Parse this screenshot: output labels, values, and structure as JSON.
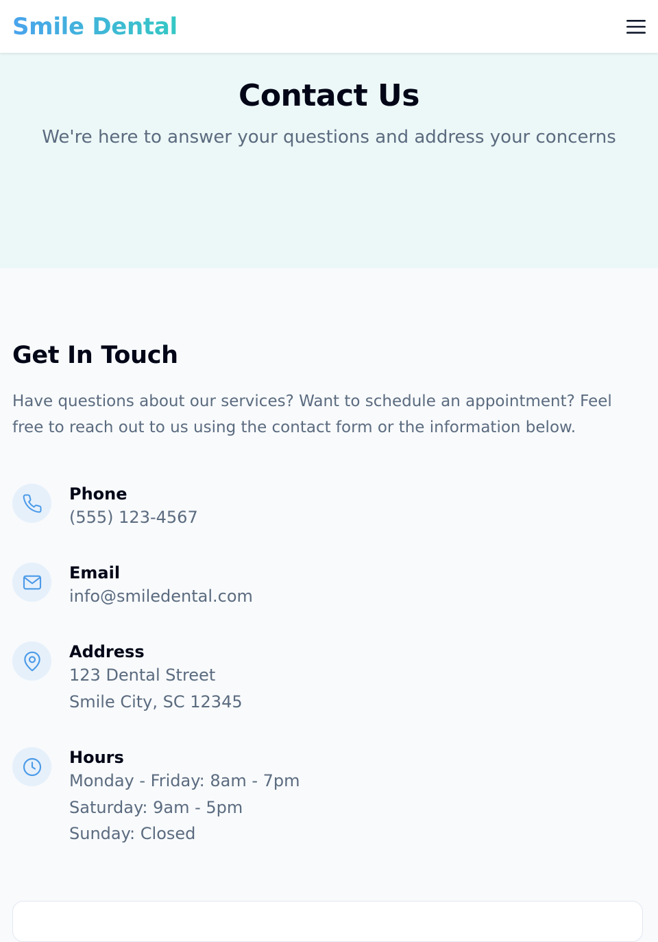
{
  "brand": {
    "name": "Smile Dental"
  },
  "hero": {
    "title": "Contact Us",
    "subtitle": "We're here to answer your questions and address your concerns"
  },
  "contact": {
    "heading": "Get In Touch",
    "intro": "Have questions about our services? Want to schedule an appointment? Feel free to reach out to us using the contact form or the information below.",
    "phone": {
      "title": "Phone",
      "value": "(555) 123-4567",
      "icon": "phone-icon"
    },
    "email": {
      "title": "Email",
      "value": "info@smiledental.com",
      "icon": "mail-icon"
    },
    "address": {
      "title": "Address",
      "lines": [
        "123 Dental Street",
        "Smile City, SC 12345"
      ],
      "icon": "map-pin-icon"
    },
    "hours": {
      "title": "Hours",
      "lines": [
        "Monday - Friday: 8am - 7pm",
        "Saturday: 9am - 5pm",
        "Sunday: Closed"
      ],
      "icon": "clock-icon"
    }
  },
  "colors": {
    "brand_start": "#4aa3ec",
    "brand_end": "#35c8c4",
    "icon_accent": "#4a9ae8",
    "hero_bg": "#ecf7f7"
  }
}
